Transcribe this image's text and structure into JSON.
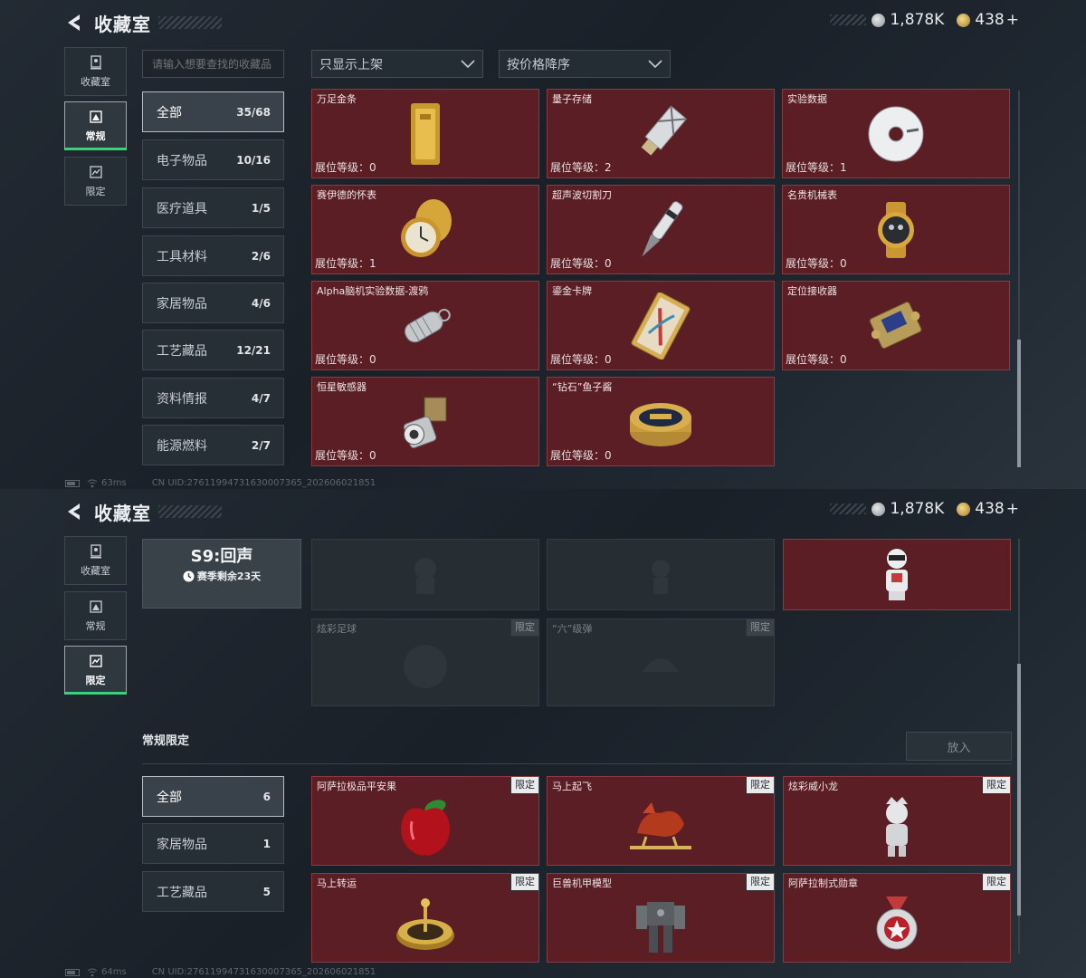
{
  "header": {
    "title": "收藏室",
    "silver": "1,878K",
    "gold": "438",
    "gold_plus": "+"
  },
  "nav": [
    {
      "label": "收藏室"
    },
    {
      "label": "常规"
    },
    {
      "label": "限定"
    }
  ],
  "screen1": {
    "search_placeholder": "请输入想要查找的收藏品",
    "filter": "只显示上架",
    "sort": "按价格降序",
    "categories": [
      {
        "label": "全部",
        "count": "35/68"
      },
      {
        "label": "电子物品",
        "count": "10/16"
      },
      {
        "label": "医疗道具",
        "count": "1/5"
      },
      {
        "label": "工具材料",
        "count": "2/6"
      },
      {
        "label": "家居物品",
        "count": "4/6"
      },
      {
        "label": "工艺藏品",
        "count": "12/21"
      },
      {
        "label": "资料情报",
        "count": "4/7"
      },
      {
        "label": "能源燃料",
        "count": "2/7"
      }
    ],
    "items": [
      {
        "name": "万足金条",
        "level": "展位等级：0",
        "icon": "gold-bar"
      },
      {
        "name": "量子存储",
        "level": "展位等级：2",
        "icon": "quantum-storage"
      },
      {
        "name": "实验数据",
        "level": "展位等级：1",
        "icon": "disc"
      },
      {
        "name": "赛伊德的怀表",
        "level": "展位等级：1",
        "icon": "pocket-watch"
      },
      {
        "name": "超声波切割刀",
        "level": "展位等级：0",
        "icon": "cutter"
      },
      {
        "name": "名贵机械表",
        "level": "展位等级：0",
        "icon": "wristwatch"
      },
      {
        "name": "Alpha脑机实验数据-渡鸦",
        "level": "展位等级：0",
        "icon": "data-capsule"
      },
      {
        "name": "鎏金卡牌",
        "level": "展位等级：0",
        "icon": "gilded-card"
      },
      {
        "name": "定位接收器",
        "level": "展位等级：0",
        "icon": "receiver"
      },
      {
        "name": "恒星敏感器",
        "level": "展位等级：0",
        "icon": "star-sensor"
      },
      {
        "name": "“钻石”鱼子酱",
        "level": "展位等级：0",
        "icon": "caviar"
      }
    ],
    "status": {
      "ping": "63ms",
      "uid": "CN UID:276119947316300073​65_202606021851"
    }
  },
  "screen2": {
    "season_title": "S9:回声",
    "season_remain": "赛季剩余23天",
    "season_items": [
      {
        "name": "",
        "tag": "",
        "icon": "locked-figure",
        "locked": true
      },
      {
        "name": "",
        "tag": "",
        "icon": "locked-figure",
        "locked": true
      },
      {
        "name": "",
        "tag": "",
        "icon": "dj-figure",
        "locked": false
      },
      {
        "name": "炫彩足球",
        "tag": "限定",
        "icon": "football",
        "locked": true
      },
      {
        "name": "“六”级弹",
        "tag": "限定",
        "icon": "shell",
        "locked": true
      }
    ],
    "section_title": "常规限定",
    "put_in": "放入",
    "categories": [
      {
        "label": "全部",
        "count": "6"
      },
      {
        "label": "家居物品",
        "count": "1"
      },
      {
        "label": "工艺藏品",
        "count": "5"
      }
    ],
    "items": [
      {
        "name": "阿萨拉极品平安果",
        "tag": "限定",
        "icon": "apple"
      },
      {
        "name": "马上起飞",
        "tag": "限定",
        "icon": "horse"
      },
      {
        "name": "炫彩威小龙",
        "tag": "限定",
        "icon": "dragon-figure"
      },
      {
        "name": "马上转运",
        "tag": "限定",
        "icon": "spinner"
      },
      {
        "name": "巨兽机甲模型",
        "tag": "限定",
        "icon": "mech"
      },
      {
        "name": "阿萨拉制式勋章",
        "tag": "限定",
        "icon": "medal"
      }
    ],
    "status": {
      "ping": "64ms",
      "uid": "CN UID:27611994731630007365_202606021851"
    }
  },
  "colors": {
    "card_bg": "#5a1e24",
    "card_border": "#8a3a40",
    "accent": "#38d27a"
  }
}
